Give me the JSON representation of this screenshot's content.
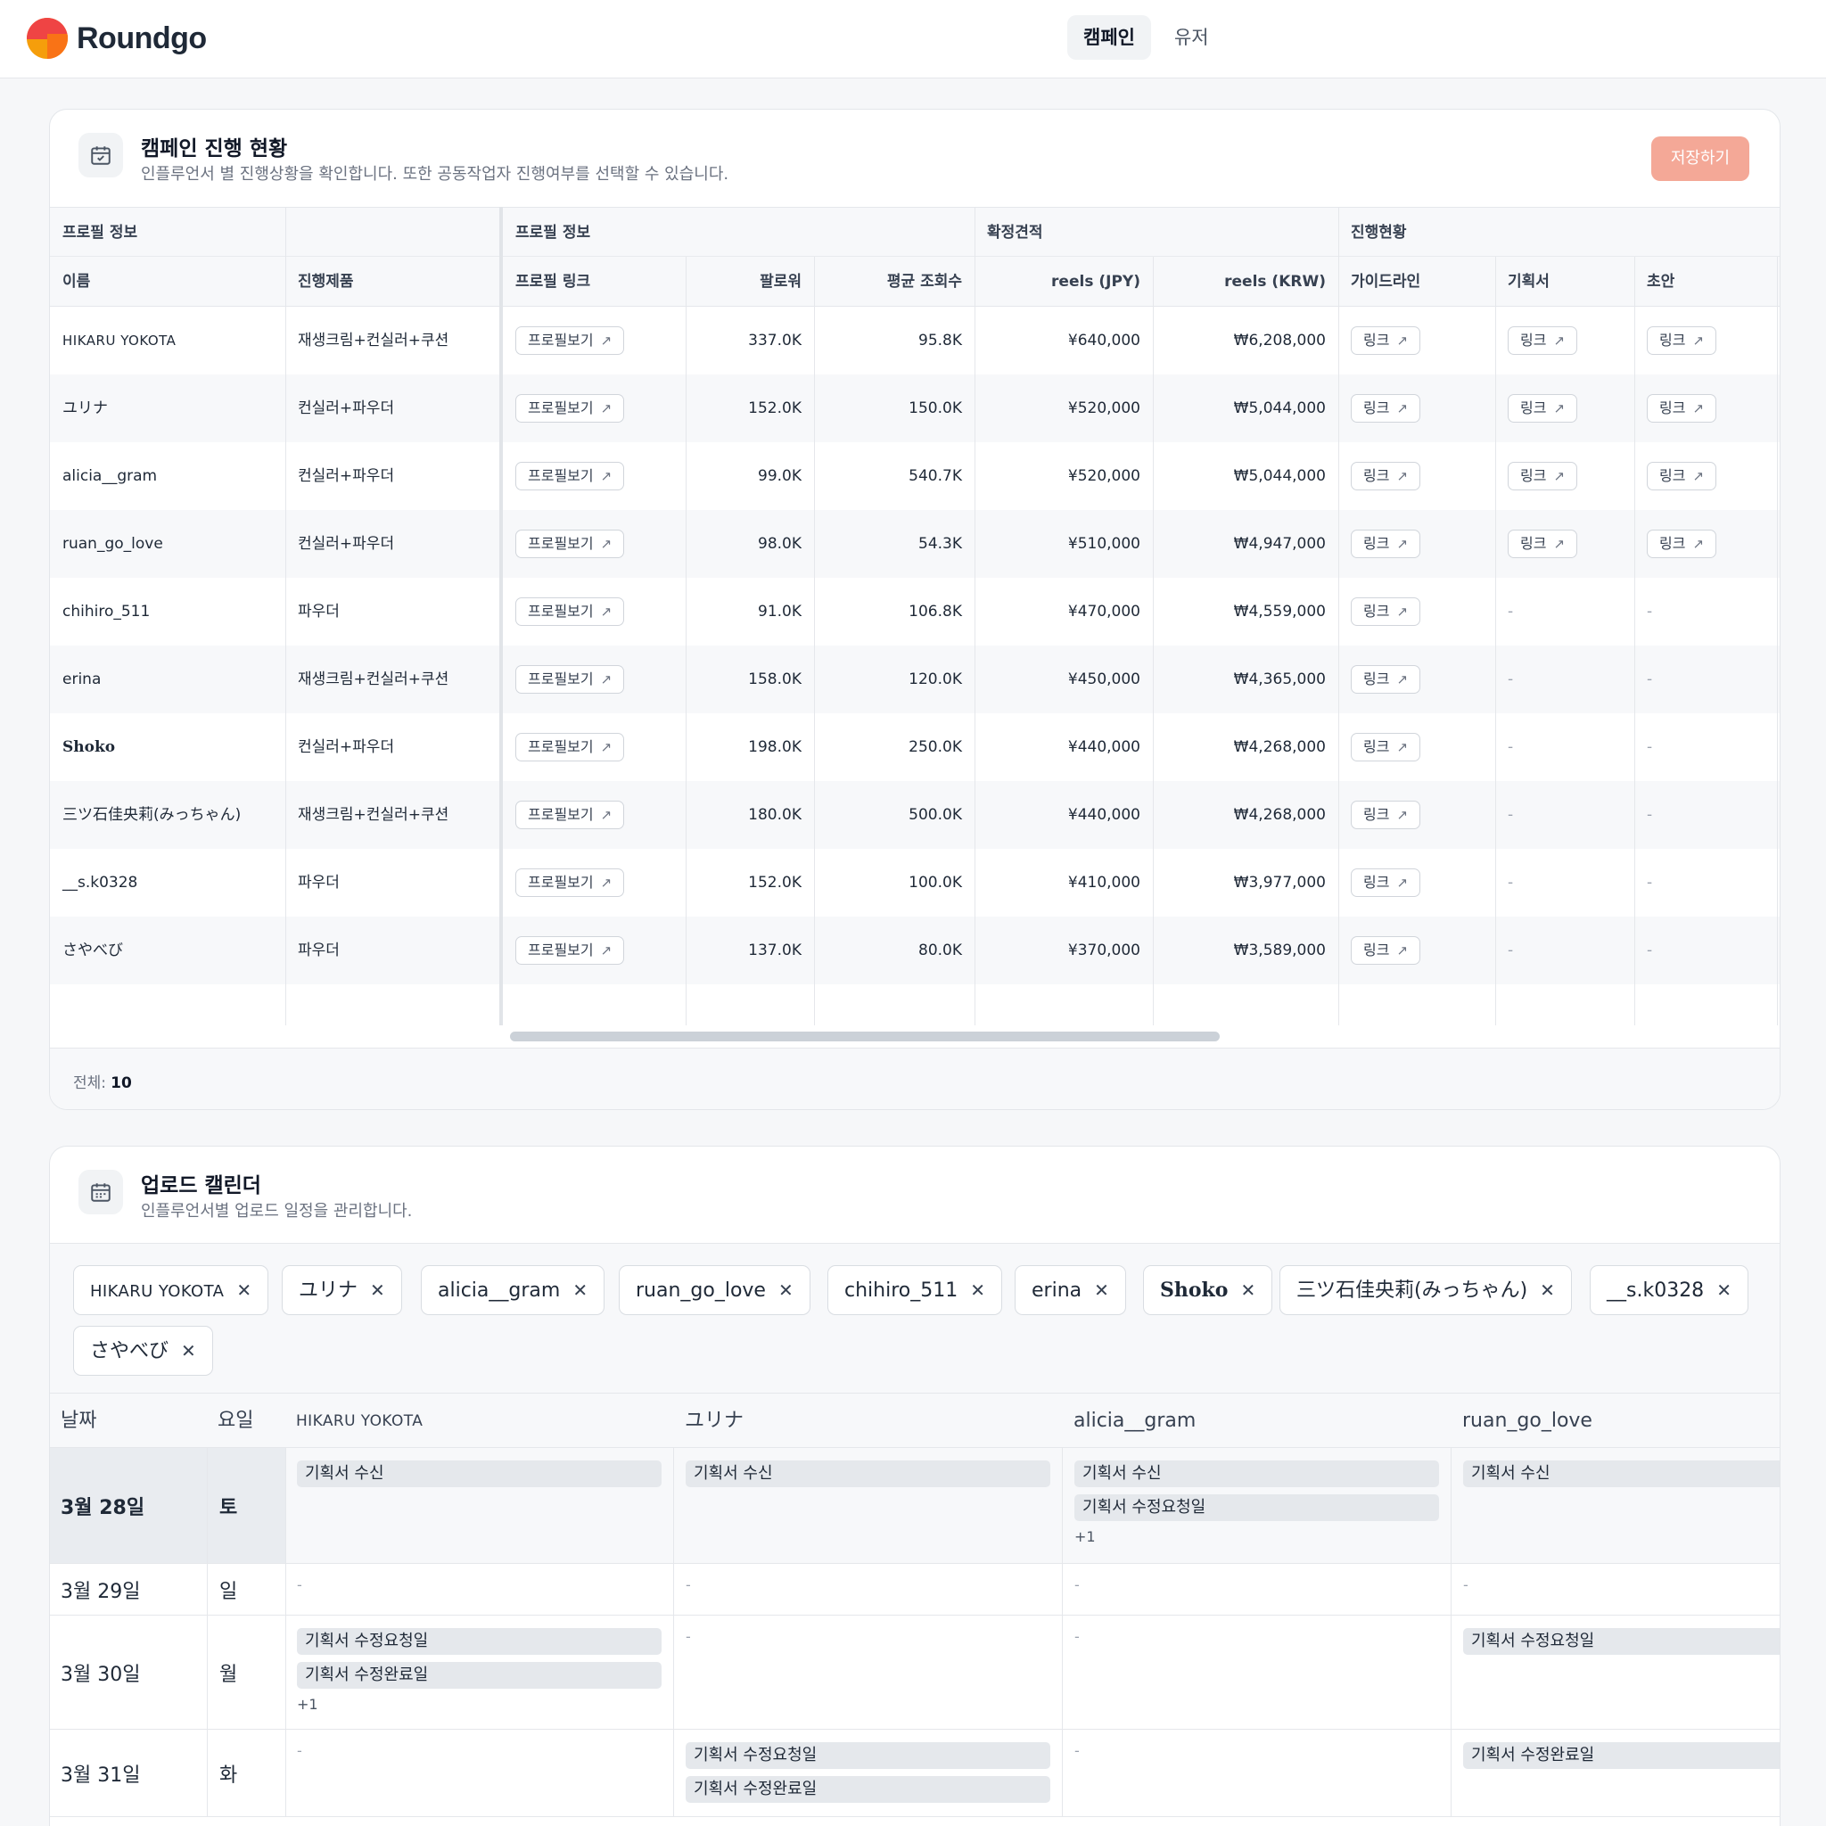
{
  "app": {
    "brand": "Roundgo",
    "nav": [
      {
        "label": "캠페인",
        "active": true
      },
      {
        "label": "유저",
        "active": false
      }
    ]
  },
  "campaign": {
    "title": "캠페인 진행 현황",
    "subtitle": "인플루언서 별 진행상황을 확인합니다. 또한 공동작업자 진행여부를 선택할 수 있습니다.",
    "save_label": "저장하기",
    "groups": [
      "프로필 정보",
      "프로필 정보",
      "확정견적",
      "진행현황"
    ],
    "columns": [
      "이름",
      "진행제품",
      "프로필 링크",
      "팔로워",
      "평균 조회수",
      "reels (JPY)",
      "reels (KRW)",
      "가이드라인",
      "기획서",
      "초안"
    ],
    "profile_button": "프로필보기",
    "link_button": "링크",
    "rows": [
      {
        "name": "HIKARU YOKOTA",
        "product": "재생크림+컨실러+쿠션",
        "followers": "337.0K",
        "views": "95.8K",
        "jpy": "¥640,000",
        "krw": "₩6,208,000",
        "guide": true,
        "plan": true,
        "draft": true
      },
      {
        "name": "ユリナ",
        "product": "컨실러+파우더",
        "followers": "152.0K",
        "views": "150.0K",
        "jpy": "¥520,000",
        "krw": "₩5,044,000",
        "guide": true,
        "plan": true,
        "draft": true
      },
      {
        "name": "alicia__gram",
        "product": "컨실러+파우더",
        "followers": "99.0K",
        "views": "540.7K",
        "jpy": "¥520,000",
        "krw": "₩5,044,000",
        "guide": true,
        "plan": true,
        "draft": true
      },
      {
        "name": "ruan_go_love",
        "product": "컨실러+파우더",
        "followers": "98.0K",
        "views": "54.3K",
        "jpy": "¥510,000",
        "krw": "₩4,947,000",
        "guide": true,
        "plan": true,
        "draft": true
      },
      {
        "name": "chihiro_511",
        "product": "파우더",
        "followers": "91.0K",
        "views": "106.8K",
        "jpy": "¥470,000",
        "krw": "₩4,559,000",
        "guide": true,
        "plan": false,
        "draft": false
      },
      {
        "name": "erina",
        "product": "재생크림+컨실러+쿠션",
        "followers": "158.0K",
        "views": "120.0K",
        "jpy": "¥450,000",
        "krw": "₩4,365,000",
        "guide": true,
        "plan": false,
        "draft": false
      },
      {
        "name": "Shoko",
        "product": "컨실러+파우더",
        "followers": "198.0K",
        "views": "250.0K",
        "jpy": "¥440,000",
        "krw": "₩4,268,000",
        "guide": true,
        "plan": false,
        "draft": false
      },
      {
        "name": "三ツ石佳央莉(みっちゃん)",
        "product": "재생크림+컨실러+쿠션",
        "followers": "180.0K",
        "views": "500.0K",
        "jpy": "¥440,000",
        "krw": "₩4,268,000",
        "guide": true,
        "plan": false,
        "draft": false
      },
      {
        "name": "__s.k0328",
        "product": "파우더",
        "followers": "152.0K",
        "views": "100.0K",
        "jpy": "¥410,000",
        "krw": "₩3,977,000",
        "guide": true,
        "plan": false,
        "draft": false
      },
      {
        "name": "さやべび",
        "product": "파우더",
        "followers": "137.0K",
        "views": "80.0K",
        "jpy": "¥370,000",
        "krw": "₩3,589,000",
        "guide": true,
        "plan": false,
        "draft": false
      }
    ],
    "total_label": "전체:",
    "total_value": "10",
    "empty": "-"
  },
  "calendar": {
    "title": "업로드 캘린더",
    "subtitle": "인플루언서별 업로드 일정을 관리합니다.",
    "chips": [
      "HIKARU YOKOTA",
      "ユリナ",
      "alicia__gram",
      "ruan_go_love",
      "chihiro_511",
      "erina",
      "Shoko",
      "三ツ石佳央莉(みっちゃん)",
      "__s.k0328",
      "さやべび"
    ],
    "columns": [
      "날짜",
      "요일",
      "HIKARU YOKOTA",
      "ユリナ",
      "alicia__gram",
      "ruan_go_love"
    ],
    "rows": [
      {
        "date": "3월 28일",
        "day": "토",
        "cells": [
          {
            "events": [
              "기획서 수신"
            ],
            "more": ""
          },
          {
            "events": [
              "기획서 수신"
            ],
            "more": ""
          },
          {
            "events": [
              "기획서 수신",
              "기획서 수정요청일"
            ],
            "more": "+1"
          },
          {
            "events": [
              "기획서 수신"
            ],
            "more": ""
          }
        ]
      },
      {
        "date": "3월 29일",
        "day": "일",
        "cells": [
          {
            "events": [],
            "more": ""
          },
          {
            "events": [],
            "more": ""
          },
          {
            "events": [],
            "more": ""
          },
          {
            "events": [],
            "more": ""
          }
        ]
      },
      {
        "date": "3월 30일",
        "day": "월",
        "cells": [
          {
            "events": [
              "기획서 수정요청일",
              "기획서 수정완료일"
            ],
            "more": "+1"
          },
          {
            "events": [],
            "more": ""
          },
          {
            "events": [],
            "more": ""
          },
          {
            "events": [
              "기획서 수정요청일"
            ],
            "more": ""
          }
        ]
      },
      {
        "date": "3월 31일",
        "day": "화",
        "cells": [
          {
            "events": [],
            "more": ""
          },
          {
            "events": [
              "기획서 수정요청일",
              "기획서 수정완료일"
            ],
            "more": ""
          },
          {
            "events": [],
            "more": ""
          },
          {
            "events": [
              "기획서 수정완료일"
            ],
            "more": ""
          }
        ]
      }
    ]
  }
}
